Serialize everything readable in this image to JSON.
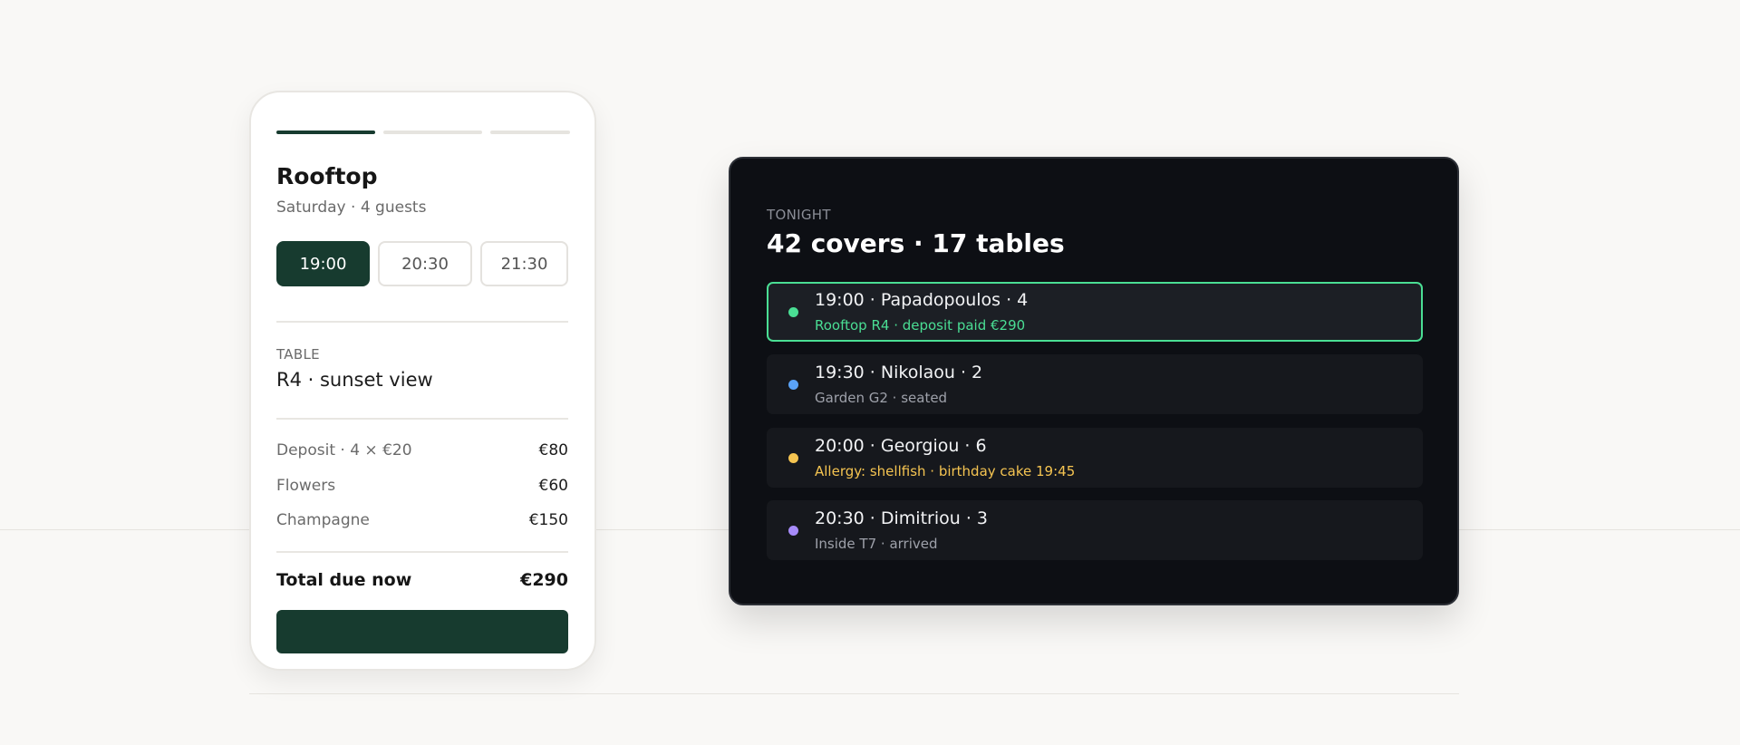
{
  "booking_form": {
    "steps": [
      {
        "state": "active"
      },
      {
        "state": "inactive"
      },
      {
        "state": "inactive"
      }
    ],
    "venue": "Rooftop",
    "subtitle": "Saturday · 4 guests",
    "time_slots": [
      {
        "label": "19:00",
        "selected": true
      },
      {
        "label": "20:30",
        "selected": false
      },
      {
        "label": "21:30",
        "selected": false
      }
    ],
    "table": {
      "label": "TABLE",
      "value": "R4 · sunset view"
    },
    "line_items": [
      {
        "label": "Deposit · 4 × €20",
        "amount": "€80"
      },
      {
        "label": "Flowers",
        "amount": "€60"
      },
      {
        "label": "Champagne",
        "amount": "€150"
      }
    ],
    "total": {
      "label": "Total due now",
      "amount": "€290"
    },
    "cta_label": ""
  },
  "dashboard": {
    "eyebrow": "TONIGHT",
    "headline": "42 covers · 17 tables",
    "bookings": [
      {
        "title": "19:00 · Papadopoulos · 4",
        "detail": "Rooftop R4 · deposit paid €290",
        "dot_color": "#4ade94",
        "detail_color": "#4ade94",
        "highlighted": true
      },
      {
        "title": "19:30 · Nikolaou · 2",
        "detail": "Garden G2 · seated",
        "dot_color": "#5aa2f7",
        "detail_color": "#9ea1aa",
        "highlighted": false
      },
      {
        "title": "20:00 · Georgiou · 6",
        "detail": "Allergy: shellfish · birthday cake 19:45",
        "dot_color": "#f5c451",
        "detail_color": "#f5c451",
        "highlighted": false
      },
      {
        "title": "20:30 · Dimitriou · 3",
        "detail": "Inside T7 · arrived",
        "dot_color": "#a78bfa",
        "detail_color": "#9ea1aa",
        "highlighted": false
      }
    ]
  },
  "colors": {
    "brand_green": "#173b2f",
    "page_background": "#f9f8f6",
    "panel_background": "#0d0f14"
  }
}
